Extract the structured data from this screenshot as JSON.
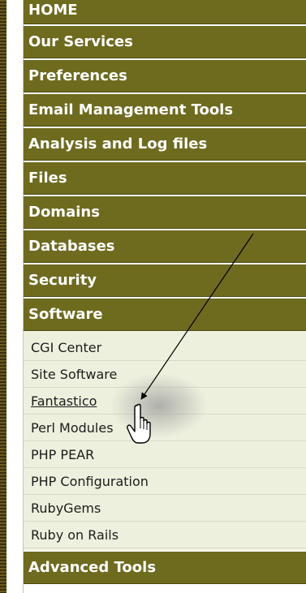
{
  "menu": {
    "categories": [
      {
        "label": "HOME"
      },
      {
        "label": "Our Services"
      },
      {
        "label": "Preferences"
      },
      {
        "label": "Email Management Tools"
      },
      {
        "label": "Analysis and Log files"
      },
      {
        "label": "Files"
      },
      {
        "label": "Domains"
      },
      {
        "label": "Databases"
      },
      {
        "label": "Security"
      },
      {
        "label": "Software"
      }
    ],
    "software_items": [
      {
        "label": "CGI Center"
      },
      {
        "label": "Site Software"
      },
      {
        "label": "Fantastico"
      },
      {
        "label": "Perl Modules"
      },
      {
        "label": "PHP PEAR"
      },
      {
        "label": "PHP Configuration"
      },
      {
        "label": "RubyGems"
      },
      {
        "label": "Ruby on Rails"
      }
    ],
    "last_category": {
      "label": "Advanced Tools"
    }
  },
  "colors": {
    "category_bg": "#6e6b1f",
    "submenu_bg": "#eef0de",
    "strip": "#4a3b12"
  },
  "annotations": {
    "pointer": "hand-pointer-icon",
    "arrow": "arrow-annotation-icon"
  }
}
